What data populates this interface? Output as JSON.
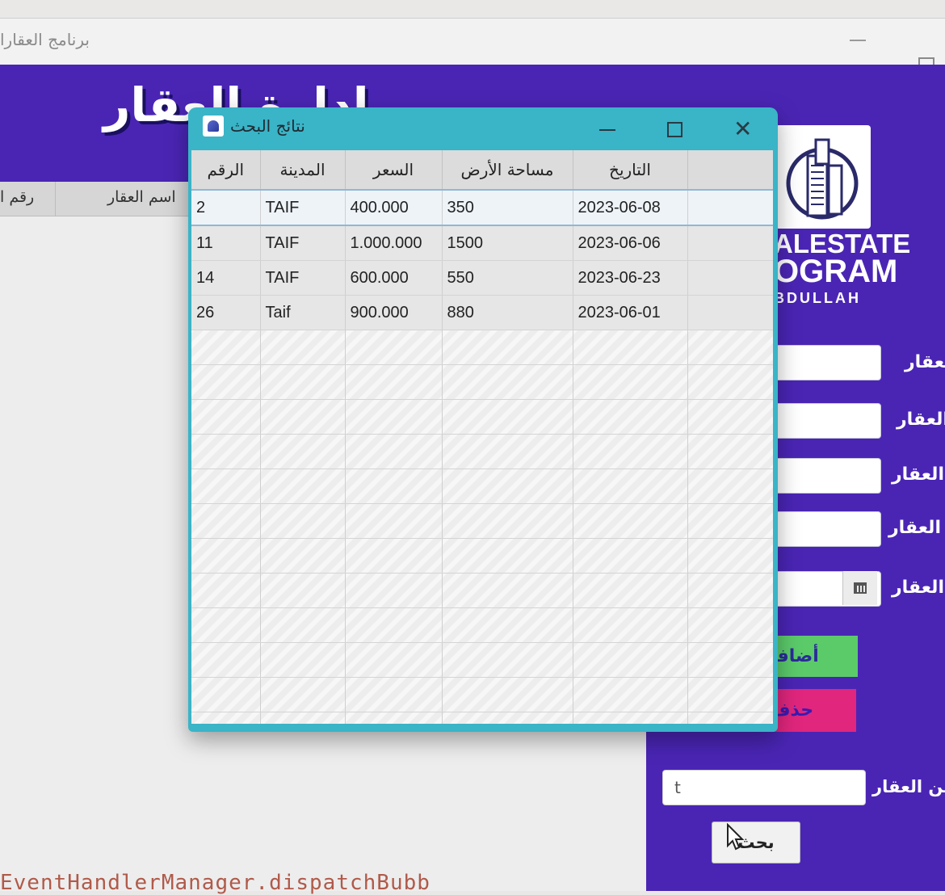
{
  "main_window": {
    "title": "برنامج العقارا",
    "header_title": "إدارة العقار"
  },
  "logo": {
    "line1": "ALESTATE",
    "line2": "OGRAM",
    "line3": "BDULLAH"
  },
  "form": {
    "labels": [
      "لعقار",
      "العقار",
      "العقار",
      "ة العقار",
      "العقار"
    ],
    "add_label": "أضافة",
    "delete_label": "حذف",
    "search_label": "عن العقار",
    "search_value": "t",
    "search_button": "بحث"
  },
  "left_table": {
    "headers": [
      "رقم ا",
      "اسم العقار"
    ]
  },
  "console": {
    "text": "EventHandlerManager.dispatchBubb"
  },
  "dialog": {
    "title": "نتائج البحث",
    "columns": [
      "الرقم",
      "المدينة",
      "السعر",
      "مساحة الأرض",
      "التاريخ",
      ""
    ],
    "rows": [
      [
        "2",
        "TAIF",
        "400.000",
        "350",
        "2023-06-08",
        ""
      ],
      [
        "11",
        "TAIF",
        "1.000.000",
        "1500",
        "2023-06-06",
        ""
      ],
      [
        "14",
        "TAIF",
        "600.000",
        "550",
        "2023-06-23",
        ""
      ],
      [
        "26",
        "Taif",
        "900.000",
        "880",
        "2023-06-01",
        ""
      ]
    ],
    "selected_row": 0
  },
  "colors": {
    "purple": "#4a25b4",
    "dialog_frame": "#3ab4c7",
    "add_green": "#5bcb6a",
    "delete_pink": "#e0267d"
  }
}
